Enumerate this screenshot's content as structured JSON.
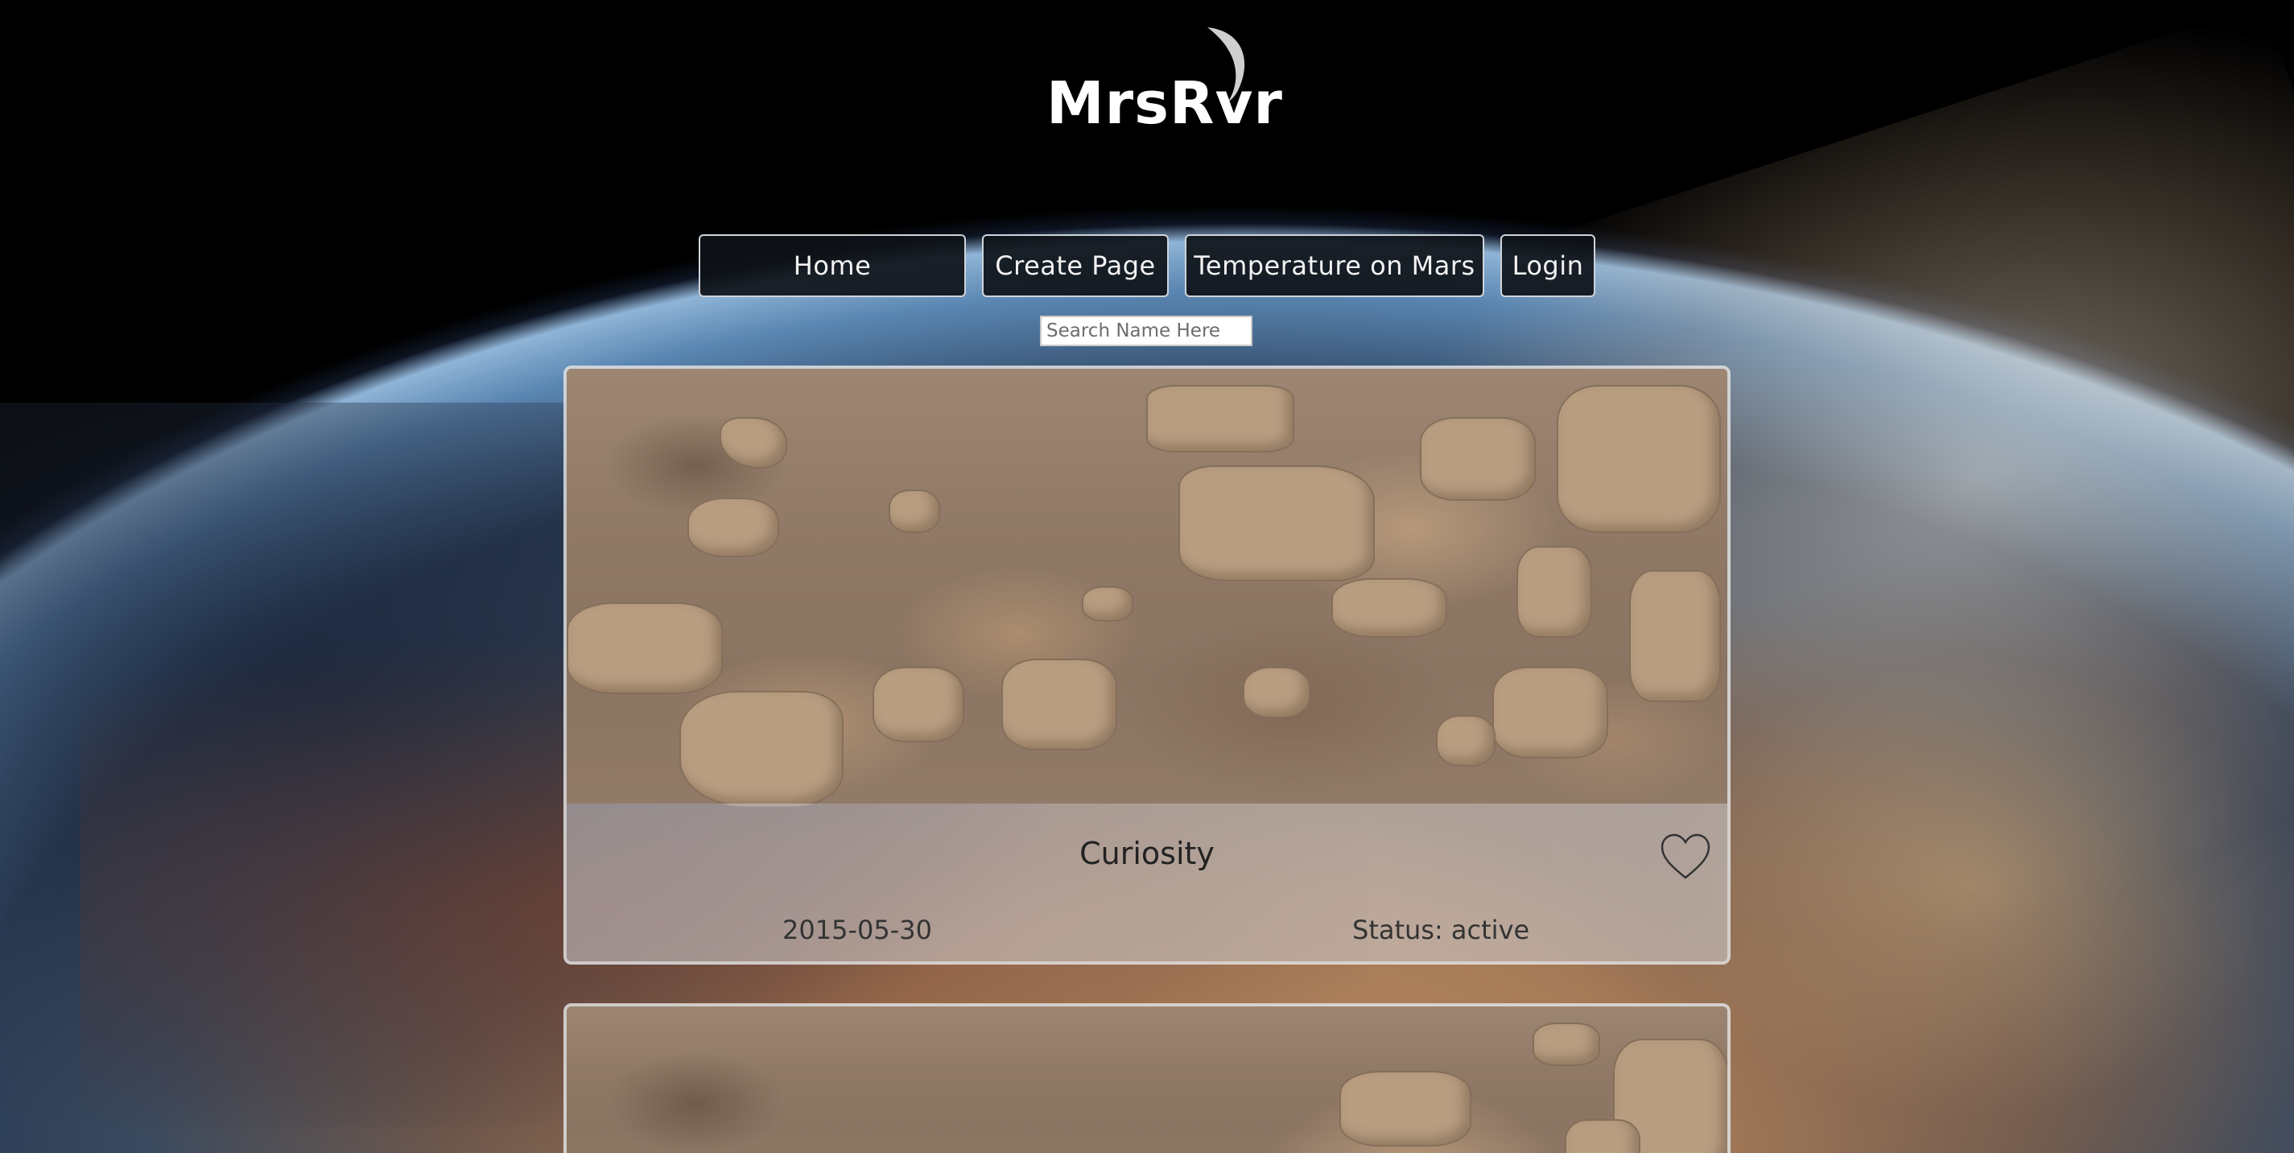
{
  "logo": {
    "text": "MrsRvr"
  },
  "nav": {
    "items": [
      {
        "label": "Home"
      },
      {
        "label": "Create Page"
      },
      {
        "label": "Temperature on Mars"
      },
      {
        "label": "Login"
      }
    ]
  },
  "search": {
    "placeholder": "Search Name Here",
    "value": ""
  },
  "cards": [
    {
      "name": "Curiosity",
      "date": "2015-05-30",
      "status": "Status: active",
      "favorite": false
    },
    {
      "name": "",
      "date": "",
      "status": ""
    }
  ],
  "icons": {
    "favorite": "heart-outline-icon",
    "logo_moon": "crescent-moon-icon"
  }
}
